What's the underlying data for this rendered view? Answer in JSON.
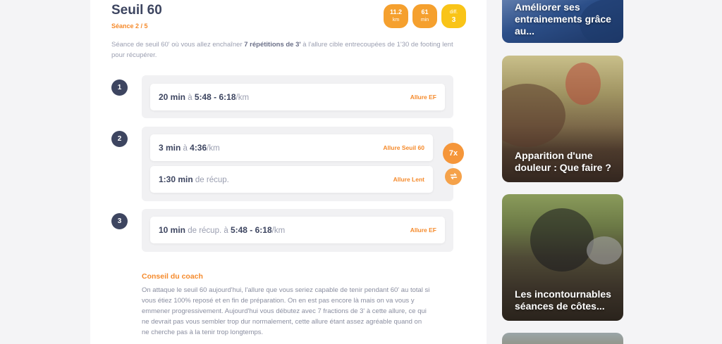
{
  "session": {
    "title": "Seuil 60",
    "subtitle": "Séance 2 / 5",
    "stats": [
      {
        "value": "11.2",
        "unit": "km"
      },
      {
        "value": "61",
        "unit": "min"
      },
      {
        "value": "diff.",
        "unit": "3"
      }
    ],
    "intro_before": "Séance de seuil 60' où vous allez enchaîner ",
    "intro_bold": "7 répétitions de 3'",
    "intro_after": " à l'allure cible entrecoupées de 1'30 de footing lent pour récupérer."
  },
  "steps": [
    {
      "number": "1",
      "rows": [
        {
          "main": "20 min",
          "connector": " à ",
          "pace": "5:48 - 6:18",
          "suffix": "/km",
          "tag": "Allure EF"
        }
      ]
    },
    {
      "number": "2",
      "repeat": "7x",
      "rows": [
        {
          "main": "3 min",
          "connector": " à ",
          "pace": "4:36",
          "suffix": "/km",
          "tag": "Allure Seuil 60"
        },
        {
          "main": "1:30 min",
          "connector": " de récup.",
          "pace": "",
          "suffix": "",
          "tag": "Allure Lent"
        }
      ]
    },
    {
      "number": "3",
      "rows": [
        {
          "main": "10 min",
          "connector": " de récup. à ",
          "pace": "5:48 - 6:18",
          "suffix": "/km",
          "tag": "Allure EF"
        }
      ]
    }
  ],
  "coach": {
    "title": "Conseil du coach",
    "text": "On attaque le seuil 60 aujourd'hui, l'allure que vous seriez capable de tenir pendant 60' au total si vous étiez 100% reposé et en fin de préparation. On en est pas encore là mais on va vous y emmener progressivement. Aujourd'hui vous débutez avec 7 fractions de 3' à cette allure, ce qui ne devrait pas vous sembler trop dur normalement, cette allure étant assez agréable quand on ne cherche pas à la tenir trop longtemps."
  },
  "articles": [
    {
      "title": "Améliorer ses entrainements grâce au..."
    },
    {
      "title": "Apparition d'une douleur : Que faire ?"
    },
    {
      "title": "Les incontournables séances de côtes..."
    }
  ],
  "colors": {
    "accent": "#f58a2b",
    "navy": "#3d4560",
    "stat_orange": "#f5a02e",
    "stat_yellow": "#f9c418"
  },
  "icons": {
    "repeat_cycle": "cycle-icon"
  }
}
